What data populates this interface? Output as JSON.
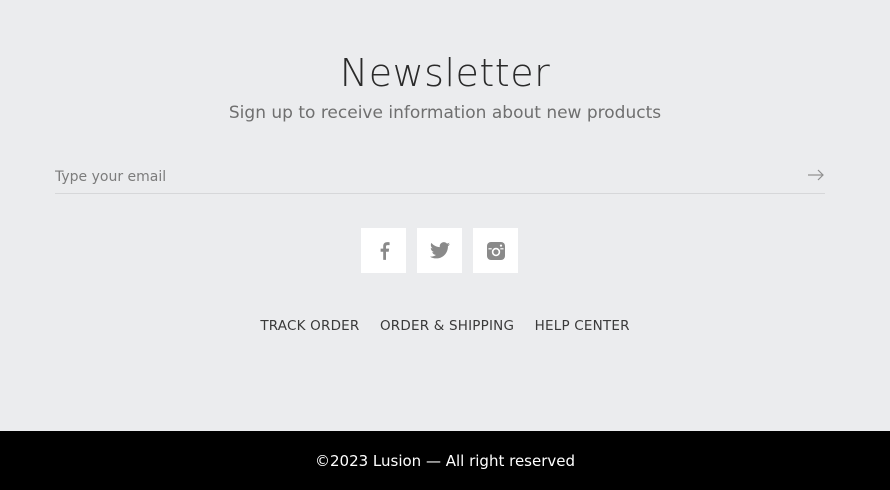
{
  "newsletter": {
    "title": "Newsletter",
    "subtitle": "Sign up to receive information about new products",
    "email_placeholder": "Type your email",
    "email_value": ""
  },
  "social": [
    {
      "icon": "facebook-icon",
      "color": "#8a8a8a"
    },
    {
      "icon": "twitter-icon",
      "color": "#8a8a8a"
    },
    {
      "icon": "instagram-icon",
      "color": "#8a8a8a"
    }
  ],
  "links": {
    "track_order": "TRACK ORDER",
    "order_shipping": "ORDER & SHIPPING",
    "help_center": "HELP CENTER"
  },
  "footer": {
    "copyright": "©2023 Lusion — All right reserved",
    "background": "#000000"
  },
  "colors": {
    "page_background": "#ebecee",
    "text_primary": "#2a2a2a",
    "text_muted": "#6f6f6f"
  }
}
